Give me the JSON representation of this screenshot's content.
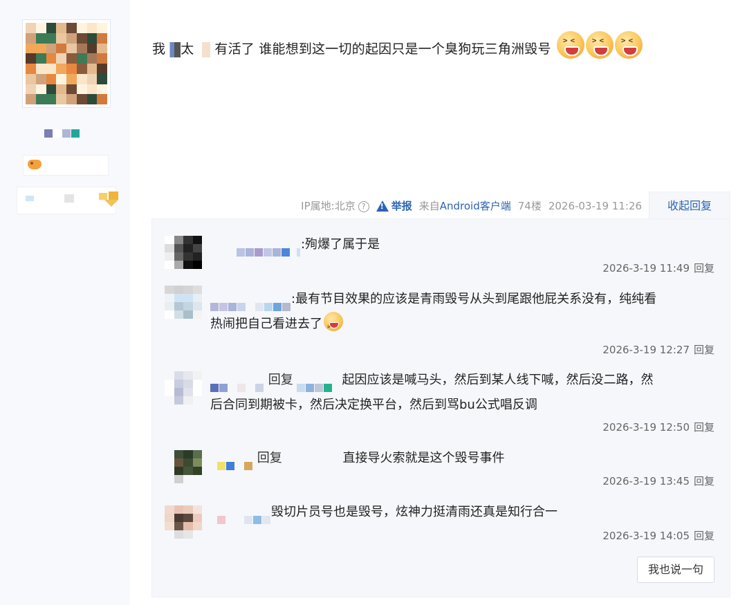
{
  "post": {
    "text_before": "我",
    "text_mid": "太",
    "text_after": "有活了 谁能想到这一切的起因只是一个臭狗玩三角洲毁号",
    "emoji_name": "angry-laugh-emoji"
  },
  "meta": {
    "ip_location": "IP属地:北京",
    "help_icon_glyph": "?",
    "report_label": "举报",
    "source": "来自",
    "client": "Android客户端",
    "floor": "74楼",
    "datetime": "2026-03-19 11:26",
    "collapse_label": "收起回复"
  },
  "replies": [
    {
      "separator": ":",
      "text": "殉爆了属于是",
      "time": "2026-3-19 11:49",
      "reply_label": "回复"
    },
    {
      "separator": ":",
      "text_line1": "最有节目效果的应该是青雨毁号从头到尾跟他屁关系没有，纯纯看",
      "text_line2": "热闹把自己看进去了",
      "time": "2026-3-19 12:27",
      "reply_label": "回复"
    },
    {
      "reply_prefix": "回复",
      "text_line1": "起因应该是喊马头，然后到某人线下喊，然后没二路，然",
      "text_line2": "后合同到期被卡，然后决定换平台，然后到骂bu公式唱反调",
      "time": "2026-3-19 12:50",
      "reply_label": "回复"
    },
    {
      "reply_prefix": "回复",
      "text": "直接导火索就是这个毁号事件",
      "time": "2026-3-19 13:45",
      "reply_label": "回复"
    },
    {
      "text": "毁切片员号也是毁号，炫神力挺清雨还真是知行合一",
      "time": "2026-3-19 14:05",
      "reply_label": "回复"
    }
  ],
  "say_button_label": "我也说一句",
  "colors": {
    "link": "#2d64b3",
    "panel_bg": "#f5f7fa",
    "author_col_bg": "#f7f9fc"
  }
}
